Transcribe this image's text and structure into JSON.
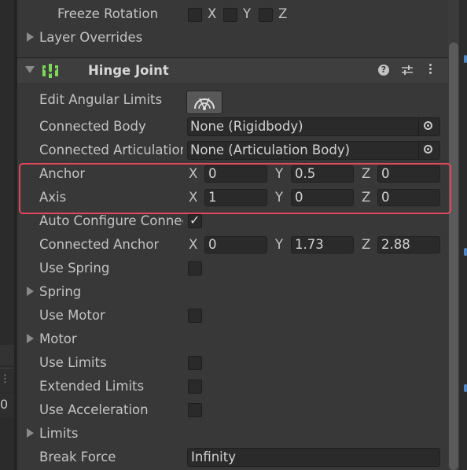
{
  "freeze_rotation": {
    "label": "Freeze Rotation",
    "x": "X",
    "y": "Y",
    "z": "Z"
  },
  "layer_overrides": {
    "label": "Layer Overrides"
  },
  "component": {
    "title": "Hinge Joint",
    "help": "?"
  },
  "properties": {
    "edit_angular_limits": "Edit Angular Limits",
    "connected_body": {
      "label": "Connected Body",
      "value": "None (Rigidbody)"
    },
    "connected_articulation": {
      "label": "Connected Articulation Body",
      "value": "None (Articulation Body)"
    },
    "anchor": {
      "label": "Anchor",
      "x": "0",
      "y": "0.5",
      "z": "0"
    },
    "axis": {
      "label": "Axis",
      "x": "1",
      "y": "0",
      "z": "0"
    },
    "auto_configure": {
      "label": "Auto Configure Connected Anchor",
      "checked": true
    },
    "connected_anchor": {
      "label": "Connected Anchor",
      "x": "0",
      "y": "1.73",
      "z": "2.88"
    },
    "use_spring": "Use Spring",
    "spring": "Spring",
    "use_motor": "Use Motor",
    "motor": "Motor",
    "use_limits": "Use Limits",
    "extended_limits": "Extended Limits",
    "use_acceleration": "Use Acceleration",
    "limits": "Limits",
    "break_force": {
      "label": "Break Force",
      "value": "Infinity"
    }
  },
  "axis_letters": {
    "x": "X",
    "y": "Y",
    "z": "Z"
  },
  "left_panel": {
    "value": "0",
    "dots": "⋮"
  },
  "colors": {
    "highlight": "#e0485b",
    "hinge_icon": "#7cd957",
    "accent": "#4f87c9"
  }
}
